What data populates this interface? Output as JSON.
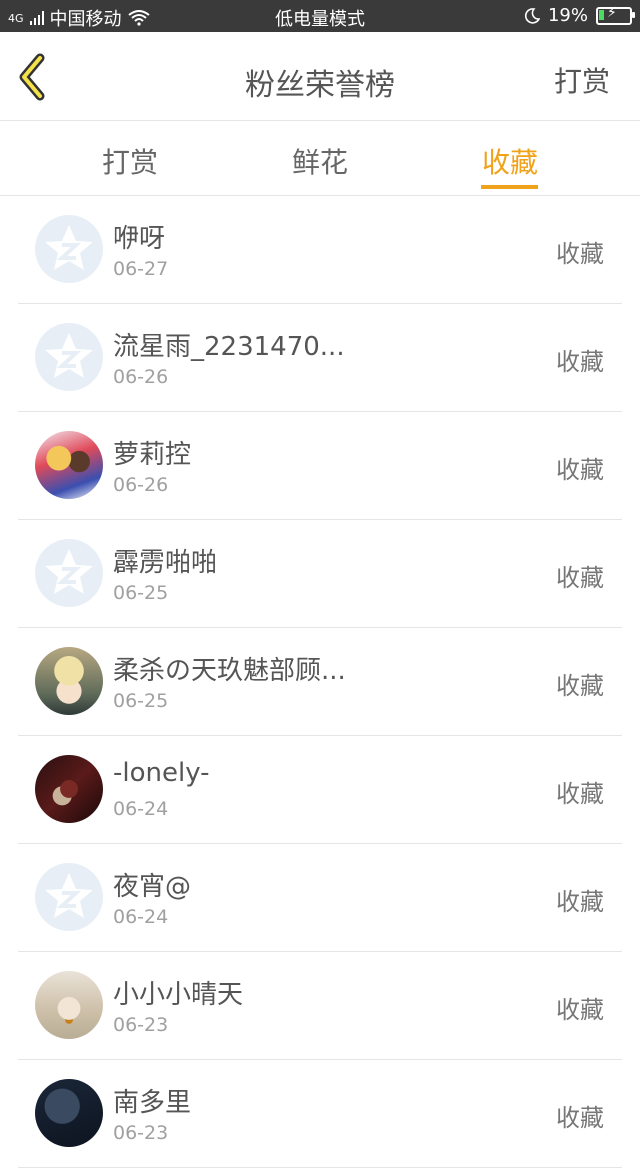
{
  "status_bar": {
    "carrier": "中国移动",
    "signal": "4G",
    "center_text": "低电量模式",
    "battery_percent": "19%",
    "battery_level": 0.19
  },
  "header": {
    "title": "粉丝荣誉榜",
    "right_button": "打赏"
  },
  "tabs": [
    {
      "label": "打赏",
      "active": false
    },
    {
      "label": "鲜花",
      "active": false
    },
    {
      "label": "收藏",
      "active": true
    }
  ],
  "list": [
    {
      "name": "咿呀",
      "date": "06-27",
      "action": "收藏",
      "avatar": "default-avatar"
    },
    {
      "name": "流星雨_2231470...",
      "date": "06-26",
      "action": "收藏",
      "avatar": "default-avatar"
    },
    {
      "name": "萝莉控",
      "date": "06-26",
      "action": "收藏",
      "avatar": "anime-avatar"
    },
    {
      "name": "霹雳啪啪",
      "date": "06-25",
      "action": "收藏",
      "avatar": "default-avatar"
    },
    {
      "name": "柔杀の天玖魅部顾...",
      "date": "06-25",
      "action": "收藏",
      "avatar": "anime-avatar"
    },
    {
      "name": "-lonely-",
      "date": "06-24",
      "action": "收藏",
      "avatar": "photo-avatar"
    },
    {
      "name": "夜宵@",
      "date": "06-24",
      "action": "收藏",
      "avatar": "default-avatar"
    },
    {
      "name": "小小小晴天",
      "date": "06-23",
      "action": "收藏",
      "avatar": "photo-avatar"
    },
    {
      "name": "南多里",
      "date": "06-23",
      "action": "收藏",
      "avatar": "photo-avatar"
    }
  ],
  "colors": {
    "accent": "#f0a21a",
    "text": "#555555",
    "muted": "#a0a0a0",
    "divider": "#e6e6e6",
    "status_bar": "#3a3a3a"
  }
}
